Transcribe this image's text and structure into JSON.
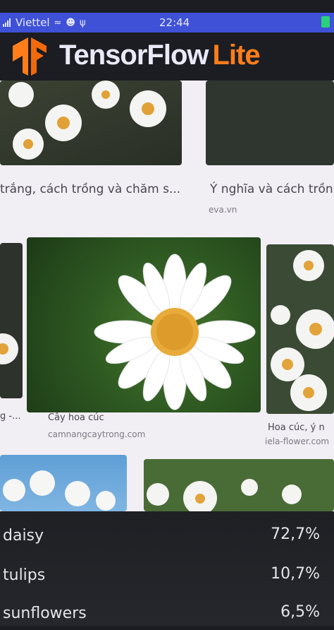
{
  "status_bar": {
    "carrier": "Viettel",
    "time": "22:44",
    "icons": [
      "signal-icon",
      "wifi-icon",
      "cat-icon",
      "usb-icon",
      "battery-icon"
    ]
  },
  "app": {
    "brand_name": "TensorFlow",
    "brand_suffix": "Lite",
    "brand_color": "#ff7d1a"
  },
  "preview": {
    "captions": {
      "top_left": "trắng, cách trồng và chăm s...",
      "top_right": "Ý nghĩa và cách trồn",
      "top_right_source": "eva.vn",
      "mid_left": "g -...",
      "mid_center": "Cây hoa cúc",
      "mid_center_source": "camnangcaytrong.com",
      "mid_right": "Hoa cúc, ý n",
      "mid_right_source": "iela-flower.com"
    }
  },
  "results": [
    {
      "label": "daisy",
      "value": "72,7%"
    },
    {
      "label": "tulips",
      "value": "10,7%"
    },
    {
      "label": "sunflowers",
      "value": "6,5%"
    }
  ]
}
